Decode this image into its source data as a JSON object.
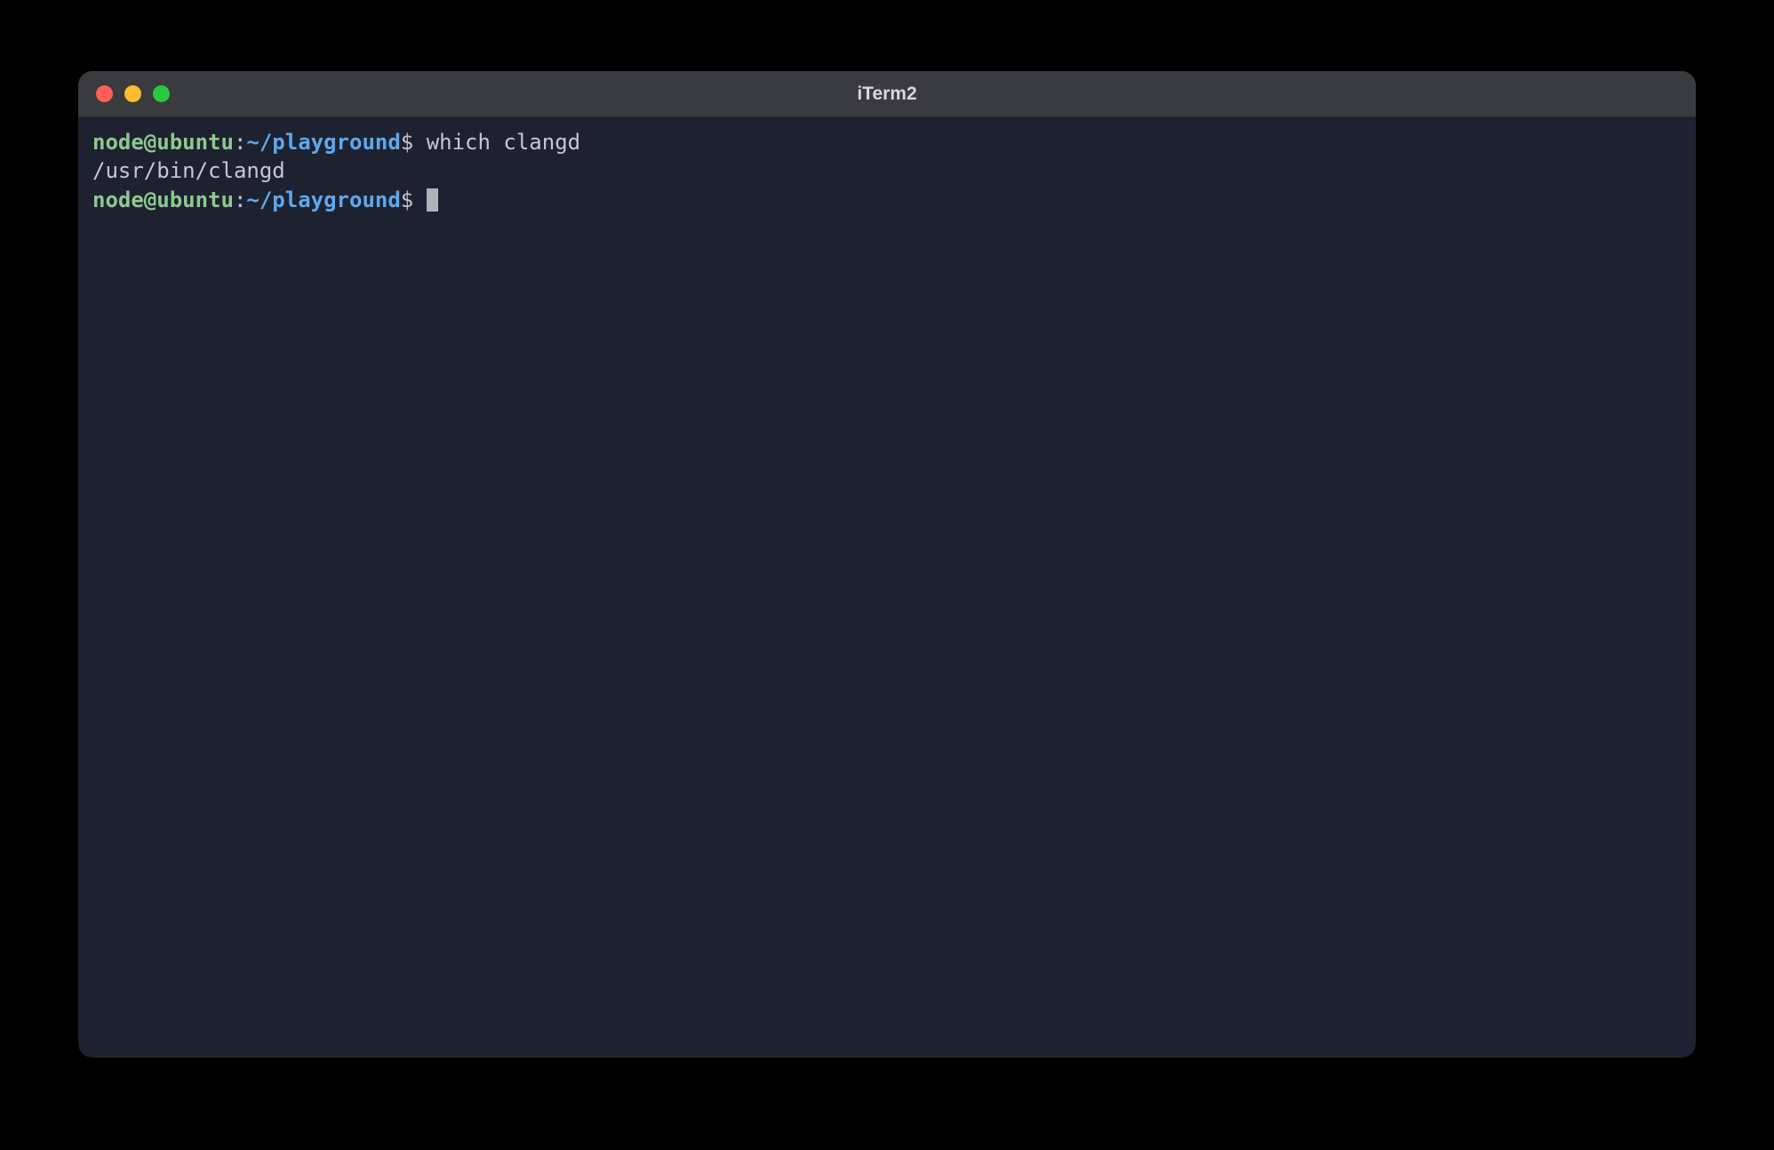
{
  "window": {
    "title": "iTerm2"
  },
  "prompt": {
    "user_host": "node@ubuntu",
    "separator": ":",
    "path": "~/playground",
    "symbol": "$"
  },
  "lines": [
    {
      "type": "command",
      "command": "which clangd"
    },
    {
      "type": "output",
      "text": "/usr/bin/clangd"
    },
    {
      "type": "prompt_cursor"
    }
  ]
}
